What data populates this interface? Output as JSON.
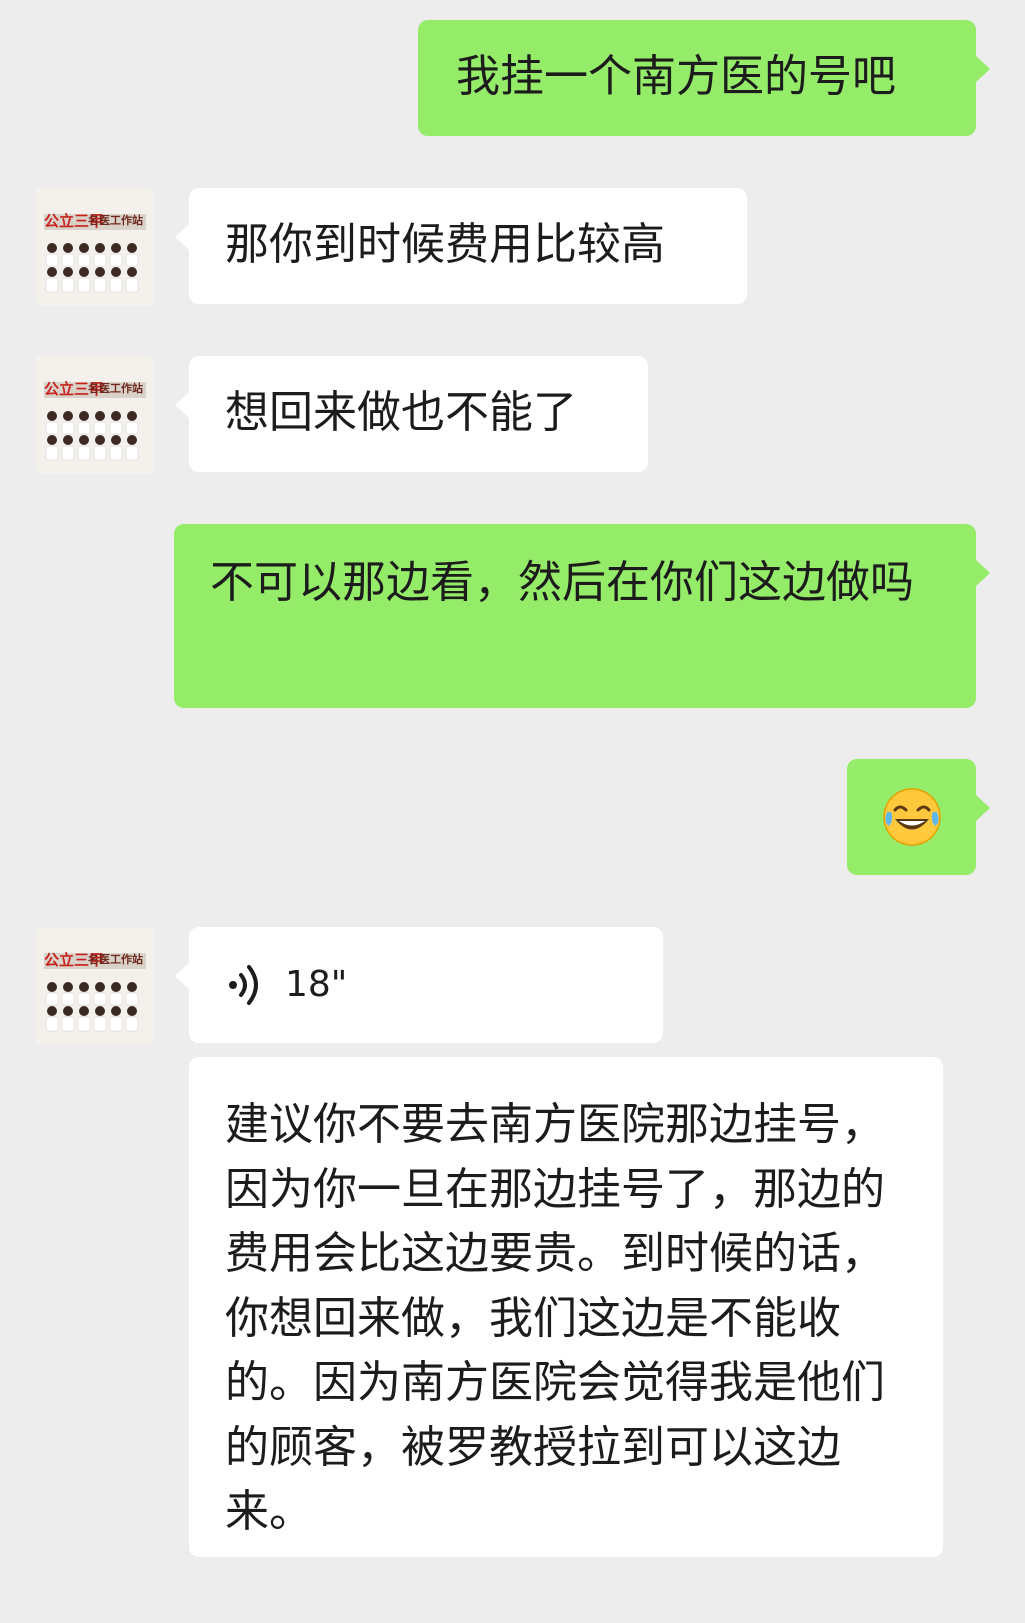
{
  "messages": [
    {
      "side": "out",
      "type": "text",
      "text": "我挂一个南方医的号吧"
    },
    {
      "side": "in",
      "type": "text",
      "text": "那你到时候费用比较高"
    },
    {
      "side": "in",
      "type": "text",
      "text": "想回来做也不能了"
    },
    {
      "side": "out",
      "type": "text",
      "text": "不可以那边看，然后在你们这边做吗"
    },
    {
      "side": "out",
      "type": "emoji",
      "emoji": "😂",
      "icon": "laughing-tears-emoji-icon"
    },
    {
      "side": "in",
      "type": "voice",
      "duration": "18\"",
      "icon": "voice-wave-icon"
    },
    {
      "side": "in",
      "type": "text",
      "text": "建议你不要去南方医院那边挂号，因为你一旦在那边挂号了，那边的费用会比这边要贵。到时候的话，你想回来做，我们这边是不能收的。因为南方医院会觉得我是他们的顾客，被罗教授拉到可以这边来。"
    }
  ],
  "avatar": {
    "icon": "hospital-doctors-group-avatar",
    "banner_text": "公立三甲",
    "banner_sub": "名医工作站"
  },
  "colors": {
    "background": "#ededed",
    "incoming_bubble": "#ffffff",
    "outgoing_bubble": "#95ec69",
    "text": "#1c1c1c",
    "avatar_accent": "#c8201e"
  }
}
